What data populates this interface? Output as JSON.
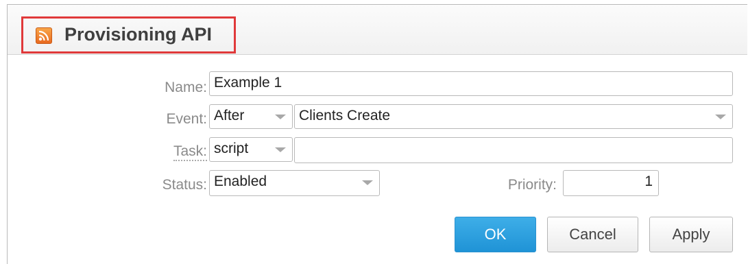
{
  "dialog": {
    "title": "Provisioning API",
    "title_icon": "rss-icon"
  },
  "form": {
    "name": {
      "label": "Name:",
      "value": "Example 1"
    },
    "event": {
      "label": "Event:",
      "timing": "After",
      "event": "Clients Create"
    },
    "task": {
      "label": "Task:",
      "type": "script",
      "value": ""
    },
    "status": {
      "label": "Status:",
      "value": "Enabled"
    },
    "priority": {
      "label": "Priority:",
      "value": "1"
    }
  },
  "buttons": {
    "ok": "OK",
    "cancel": "Cancel",
    "apply": "Apply"
  },
  "colors": {
    "accent": "#1f93d6",
    "highlight_border": "#e0393a",
    "rss_orange": "#e8691f"
  }
}
